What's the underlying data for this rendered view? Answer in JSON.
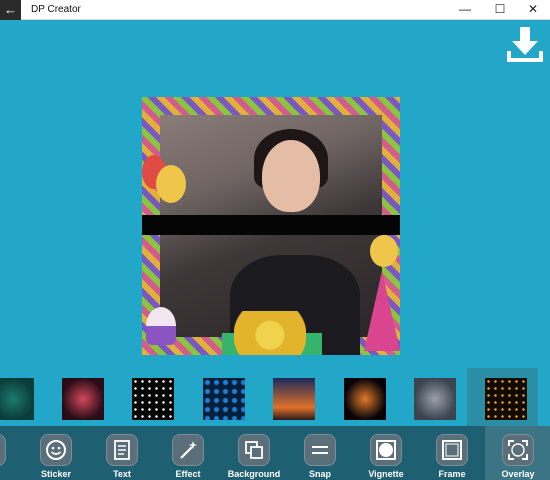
{
  "window": {
    "title": "DP Creator",
    "back_glyph": "←",
    "minimize_glyph": "—",
    "maximize_glyph": "☐",
    "close_glyph": "✕"
  },
  "download": {
    "icon": "download-icon"
  },
  "thumbnails": [
    {
      "name": "thumb-teal-nebula",
      "colors": [
        "#0b3c3a",
        "#1a7a6b"
      ]
    },
    {
      "name": "thumb-red-nebula",
      "colors": [
        "#2a0c16",
        "#d2485c"
      ]
    },
    {
      "name": "thumb-starfield",
      "colors": [
        "#050505",
        "#ffffff"
      ]
    },
    {
      "name": "thumb-blue-bokeh",
      "colors": [
        "#04203a",
        "#1f7fd6"
      ]
    },
    {
      "name": "thumb-sunset",
      "colors": [
        "#1a2a5a",
        "#e0702a"
      ]
    },
    {
      "name": "thumb-sparkle",
      "colors": [
        "#050308",
        "#e07a2a"
      ]
    },
    {
      "name": "thumb-smoke",
      "colors": [
        "#3c4450",
        "#9aa0a8"
      ]
    },
    {
      "name": "thumb-gold-dots",
      "colors": [
        "#120a05",
        "#f0a830"
      ],
      "selected": true
    }
  ],
  "tools": [
    {
      "label": "Sticker",
      "icon": "smiley-icon"
    },
    {
      "label": "Text",
      "icon": "text-icon"
    },
    {
      "label": "Effect",
      "icon": "magic-wand-icon"
    },
    {
      "label": "Background",
      "icon": "layers-icon"
    },
    {
      "label": "Snap",
      "icon": "snap-icon"
    },
    {
      "label": "Vignette",
      "icon": "vignette-icon"
    },
    {
      "label": "Frame",
      "icon": "frame-icon"
    },
    {
      "label": "Overlay",
      "icon": "overlay-icon",
      "active": true
    }
  ],
  "colors": {
    "background": "#22a7c8",
    "toolbar": "#1e5f72",
    "accent_white": "#ffffff"
  }
}
